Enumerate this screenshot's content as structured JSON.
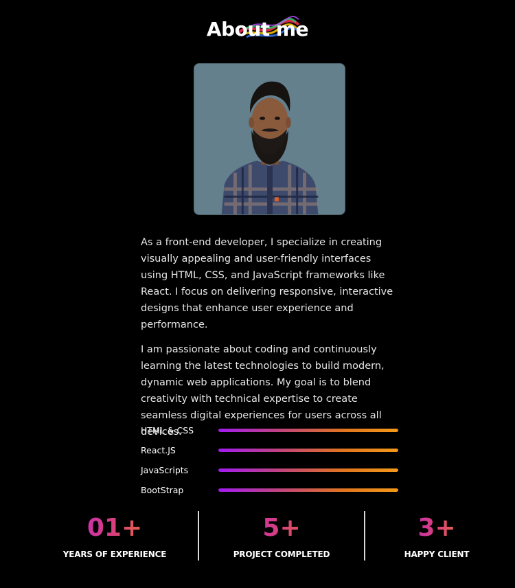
{
  "section": {
    "title": "About me"
  },
  "profile": {
    "photo_alt": "Portrait of developer"
  },
  "about": {
    "paragraphs": [
      "As a front-end developer, I specialize in creating visually appealing and user-friendly interfaces using HTML, CSS, and JavaScript frameworks like React. I focus on delivering responsive, interactive designs that enhance user experience and performance.",
      "I am passionate about coding and continuously learning the latest technologies to build modern, dynamic web applications. My goal is to blend creativity with technical expertise to create seamless digital experiences for users across all devices."
    ]
  },
  "skills": [
    {
      "name": "HTML & CSS",
      "level": 1.0
    },
    {
      "name": "React.JS",
      "level": 1.0
    },
    {
      "name": "JavaScripts",
      "level": 1.0
    },
    {
      "name": "BootStrap",
      "level": 1.0
    }
  ],
  "stats": [
    {
      "value": "01+",
      "label": "YEARS OF EXPERIENCE"
    },
    {
      "value": "5+",
      "label": "PROJECT COMPLETED"
    },
    {
      "value": "3+",
      "label": "HAPPY CLIENT"
    }
  ],
  "colors": {
    "background": "#000000",
    "gradient_start": "#a21cf0",
    "gradient_end": "#f39a1a",
    "text": "#ffffff"
  }
}
